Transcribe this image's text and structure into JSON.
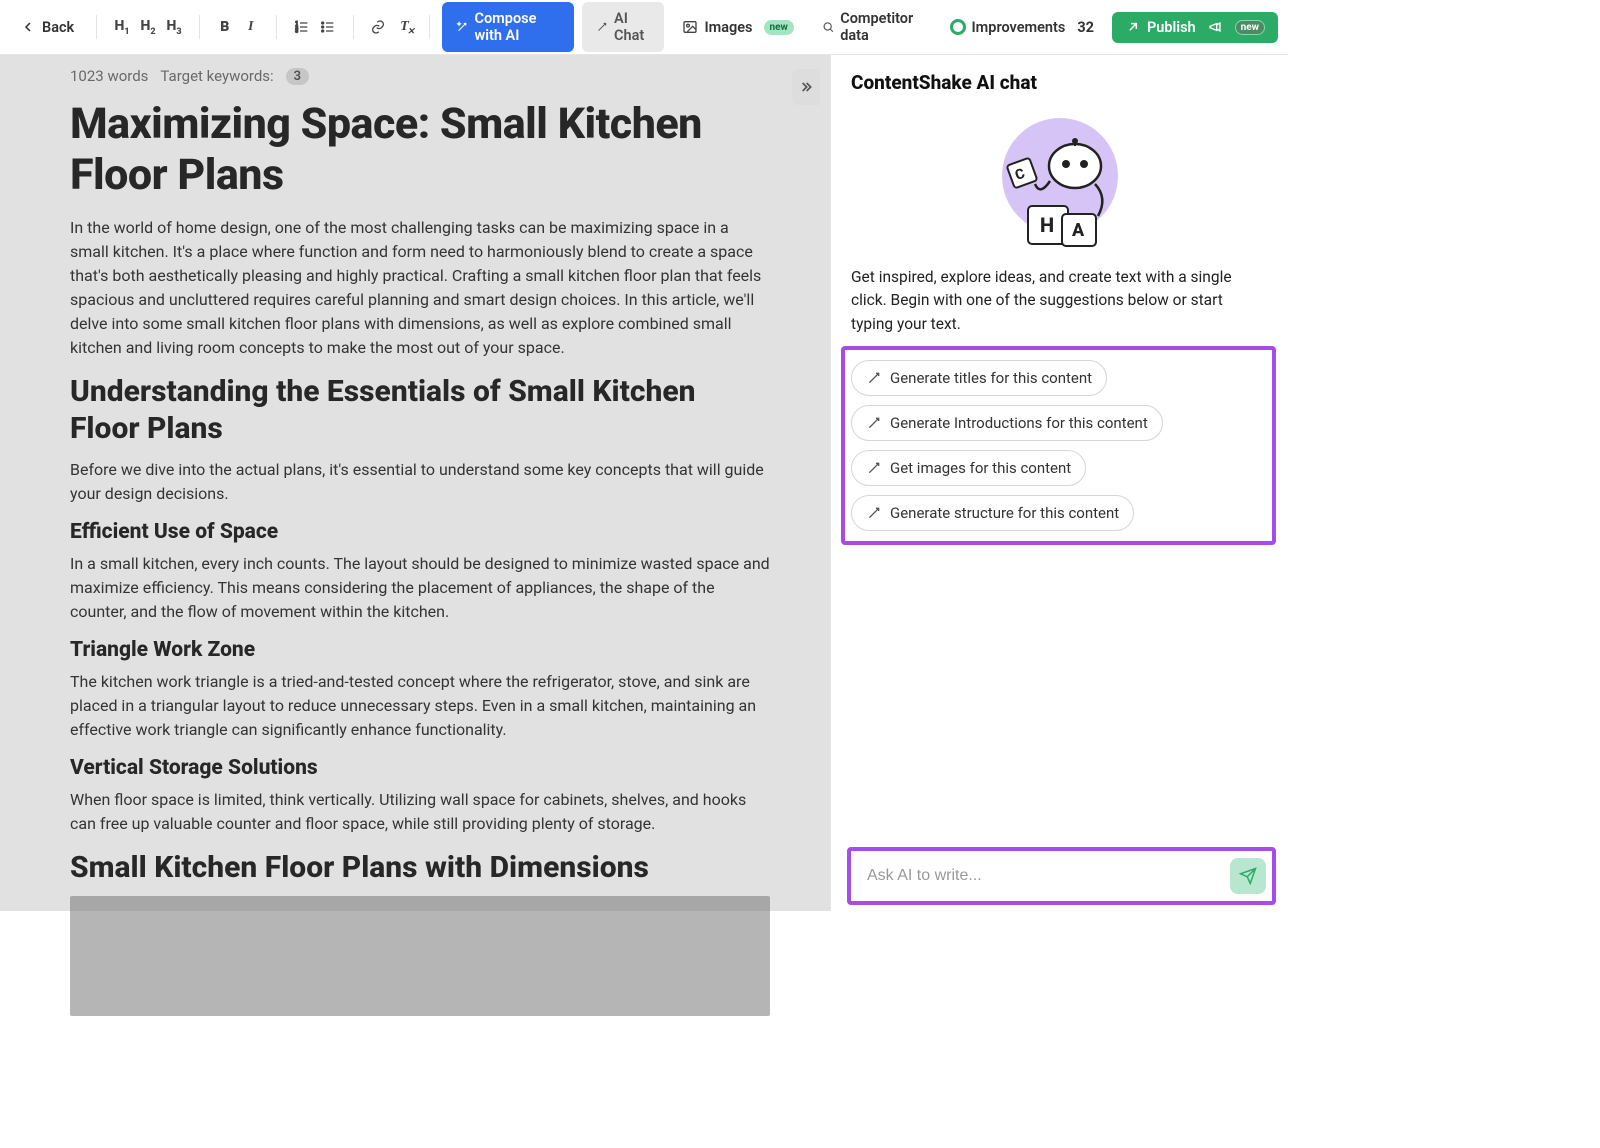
{
  "toolbar": {
    "back": "Back",
    "compose": "Compose with AI",
    "ai_chat": "AI Chat",
    "images": "Images",
    "images_badge": "new",
    "competitor": "Competitor data",
    "improvements": "Improvements",
    "improvements_count": "32",
    "publish": "Publish",
    "publish_badge": "new"
  },
  "meta": {
    "word_count": "1023 words",
    "keywords_label": "Target keywords:",
    "keywords_count": "3"
  },
  "doc": {
    "title": "Maximizing Space: Small Kitchen Floor Plans",
    "p1": "In the world of home design, one of the most challenging tasks can be maximizing space in a small kitchen. It's a place where function and form need to harmoniously blend to create a space that's both aesthetically pleasing and highly practical. Crafting a small kitchen floor plan that feels spacious and uncluttered requires careful planning and smart design choices. In this article, we'll delve into some small kitchen floor plans with dimensions, as well as explore combined small kitchen and living room concepts to make the most out of your space.",
    "h2a": "Understanding the Essentials of Small Kitchen Floor Plans",
    "p2": "Before we dive into the actual plans, it's essential to understand some key concepts that will guide your design decisions.",
    "h3a": "Efficient Use of Space",
    "p3": "In a small kitchen, every inch counts. The layout should be designed to minimize wasted space and maximize efficiency. This means considering the placement of appliances, the shape of the counter, and the flow of movement within the kitchen.",
    "h3b": "Triangle Work Zone",
    "p4": "The kitchen work triangle is a tried-and-tested concept where the refrigerator, stove, and sink are placed in a triangular layout to reduce unnecessary steps. Even in a small kitchen, maintaining an effective work triangle can significantly enhance functionality.",
    "h3c": "Vertical Storage Solutions",
    "p5": "When floor space is limited, think vertically. Utilizing wall space for cabinets, shelves, and hooks can free up valuable counter and floor space, while still providing plenty of storage.",
    "h2b": "Small Kitchen Floor Plans with Dimensions"
  },
  "chat": {
    "title": "ContentShake AI chat",
    "intro": "Get inspired, explore ideas, and create text with a single click. Begin with one of the suggestions below or start typing your text.",
    "suggestions": {
      "s1": "Generate titles for this content",
      "s2": "Generate Introductions for this content",
      "s3": "Get images for this content",
      "s4": "Generate structure for this content"
    },
    "placeholder": "Ask AI to write..."
  }
}
